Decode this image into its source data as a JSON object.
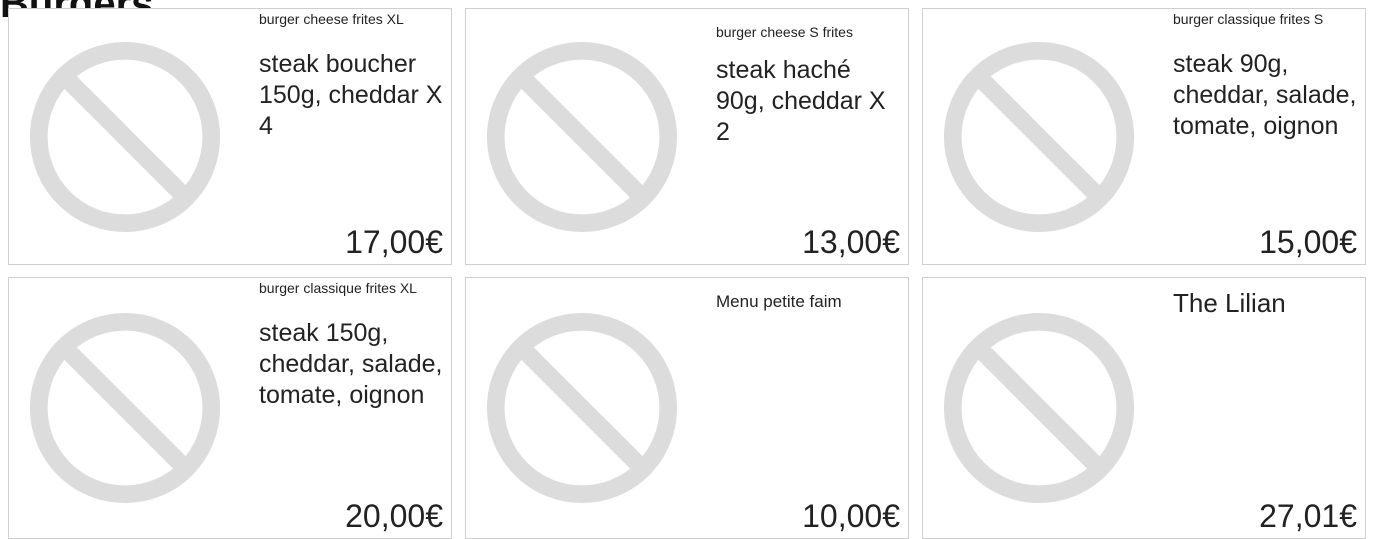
{
  "section": {
    "title": "Burgers"
  },
  "products": [
    {
      "name": "burger cheese frites XL",
      "description": "steak boucher 150g, cheddar X 4",
      "price": "17,00€"
    },
    {
      "name": "burger cheese S frites",
      "description": "steak haché 90g, cheddar X 2",
      "price": "13,00€"
    },
    {
      "name": "burger classique frites S",
      "description": "steak 90g, cheddar, salade, tomate, oignon",
      "price": "15,00€"
    },
    {
      "name": "burger classique frites XL",
      "description": "steak 150g, cheddar, salade, tomate, oignon",
      "price": "20,00€"
    },
    {
      "name": "Menu petite faim",
      "description": "",
      "price": "10,00€"
    },
    {
      "name": "The Lilian",
      "description": "",
      "price": "27,01€"
    }
  ],
  "icons": {
    "placeholder": "no-image-icon"
  },
  "colors": {
    "placeholder": "#dcdcdc",
    "border": "#cfcfcf",
    "text": "#222222"
  }
}
